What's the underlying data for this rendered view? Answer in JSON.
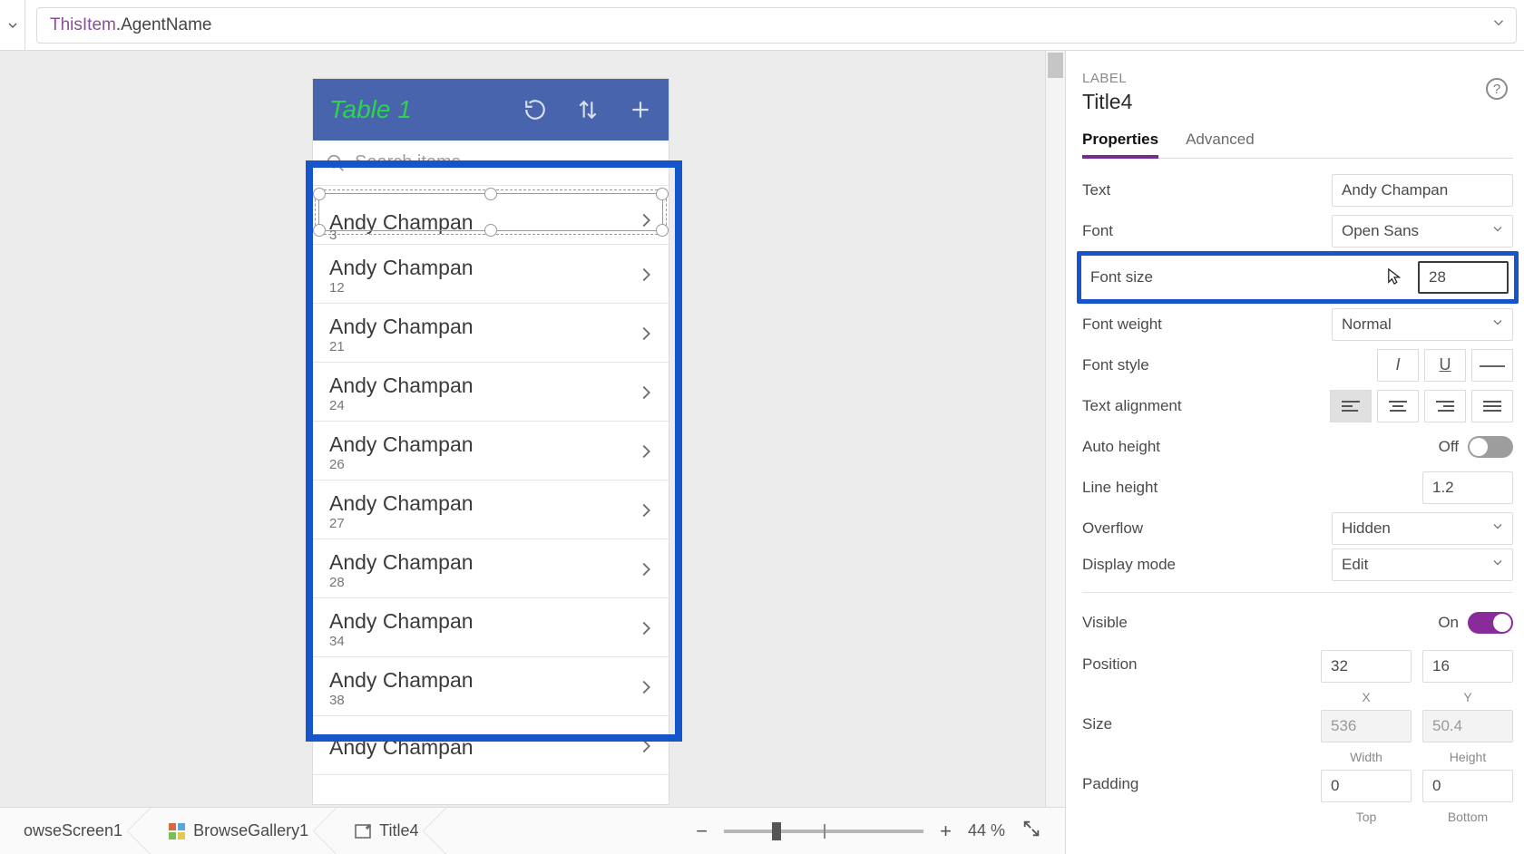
{
  "formula_bar": {
    "object_token": "ThisItem",
    "plain_token": ".AgentName"
  },
  "phone": {
    "title": "Table 1",
    "search_placeholder": "Search items",
    "rows": [
      {
        "name": "Andy Champan",
        "sub": "3"
      },
      {
        "name": "Andy Champan",
        "sub": "12"
      },
      {
        "name": "Andy Champan",
        "sub": "21"
      },
      {
        "name": "Andy Champan",
        "sub": "24"
      },
      {
        "name": "Andy Champan",
        "sub": "26"
      },
      {
        "name": "Andy Champan",
        "sub": "27"
      },
      {
        "name": "Andy Champan",
        "sub": "28"
      },
      {
        "name": "Andy Champan",
        "sub": "34"
      },
      {
        "name": "Andy Champan",
        "sub": "38"
      },
      {
        "name": "Andy Champan",
        "sub": ""
      }
    ]
  },
  "panel": {
    "section": "LABEL",
    "element": "Title4",
    "tabs": {
      "properties": "Properties",
      "advanced": "Advanced"
    },
    "props": {
      "text_label": "Text",
      "text_value": "Andy Champan",
      "font_label": "Font",
      "font_value": "Open Sans",
      "fontsize_label": "Font size",
      "fontsize_value": "28",
      "fontweight_label": "Font weight",
      "fontweight_value": "Normal",
      "fontstyle_label": "Font style",
      "align_label": "Text alignment",
      "autoheight_label": "Auto height",
      "autoheight_state": "Off",
      "lineheight_label": "Line height",
      "lineheight_value": "1.2",
      "overflow_label": "Overflow",
      "overflow_value": "Hidden",
      "displaymode_label": "Display mode",
      "displaymode_value": "Edit",
      "visible_label": "Visible",
      "visible_state": "On",
      "position_label": "Position",
      "pos_x": "32",
      "pos_y": "16",
      "pos_x_sub": "X",
      "pos_y_sub": "Y",
      "size_label": "Size",
      "size_w": "536",
      "size_h": "50.4",
      "size_w_sub": "Width",
      "size_h_sub": "Height",
      "padding_label": "Padding",
      "pad_t": "0",
      "pad_b": "0",
      "pad_t_sub": "Top",
      "pad_b_sub": "Bottom"
    }
  },
  "footer": {
    "crumb1": "owseScreen1",
    "crumb2": "BrowseGallery1",
    "crumb3": "Title4",
    "zoom_pct": "44",
    "zoom_unit": "%"
  },
  "icons": {
    "italic": "I",
    "underline": "U"
  }
}
